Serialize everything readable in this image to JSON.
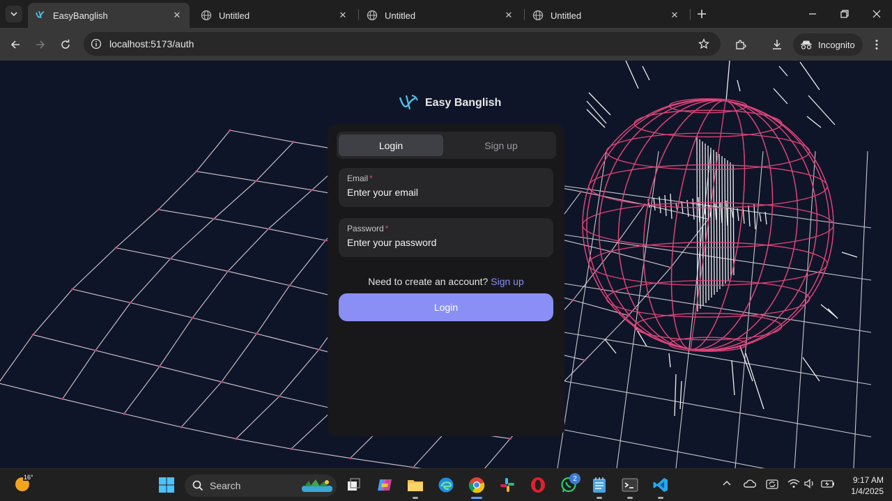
{
  "browser": {
    "tabs": [
      {
        "title": "EasyBanglish",
        "active": true
      },
      {
        "title": "Untitled",
        "active": false
      },
      {
        "title": "Untitled",
        "active": false
      },
      {
        "title": "Untitled",
        "active": false
      }
    ],
    "url": "localhost:5173/auth",
    "incognito_label": "Incognito"
  },
  "page": {
    "brand": "Easy Banglish",
    "tabs": {
      "login": "Login",
      "signup": "Sign up"
    },
    "email": {
      "label": "Email",
      "required_mark": "*",
      "placeholder": "Enter your email"
    },
    "password": {
      "label": "Password",
      "required_mark": "*",
      "placeholder": "Enter your password"
    },
    "switch_prompt": "Need to create an account?",
    "switch_link": "Sign up",
    "submit": "Login",
    "colors": {
      "accent": "#8a8ff5",
      "sphere": "#e0457b",
      "background": "#0f1528",
      "card": "#18181b"
    }
  },
  "taskbar": {
    "weather_temp": "16°",
    "search_placeholder": "Search",
    "whatsapp_badge": "2",
    "time": "9:17 AM",
    "date": "1/4/2025"
  }
}
